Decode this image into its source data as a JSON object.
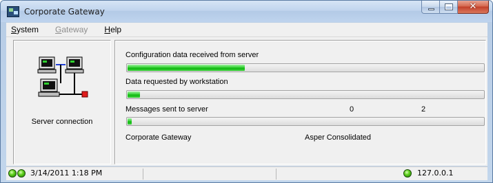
{
  "window": {
    "title": "Corporate Gateway",
    "icon": "network-gateway-icon",
    "controls": {
      "minimize": "minimize-icon",
      "maximize": "maximize-icon",
      "close": "close-icon"
    }
  },
  "menu": {
    "items": [
      {
        "label": "System",
        "accel": "S",
        "rest": "ystem",
        "enabled": true
      },
      {
        "label": "Gateway",
        "accel": "G",
        "rest": "ateway",
        "enabled": false
      },
      {
        "label": "Help",
        "accel": "H",
        "rest": "elp",
        "enabled": true
      }
    ]
  },
  "left_panel": {
    "icon": "network-computers-icon",
    "label": "Server connection"
  },
  "progress": {
    "config_received": {
      "label": "Configuration data received from server",
      "value": 0.33
    },
    "data_requested": {
      "label": "Data requested by workstation",
      "value": 0.035
    },
    "messages_sent": {
      "label": "Messages sent to server",
      "count_a": "0",
      "count_b": "2",
      "value": 0.012
    }
  },
  "info": {
    "product": "Corporate Gateway",
    "company": "Asper Consolidated"
  },
  "status_bar": {
    "datetime": "3/14/2011 1:18 PM",
    "address": "127.0.0.1",
    "led_color": "#3cc413"
  }
}
